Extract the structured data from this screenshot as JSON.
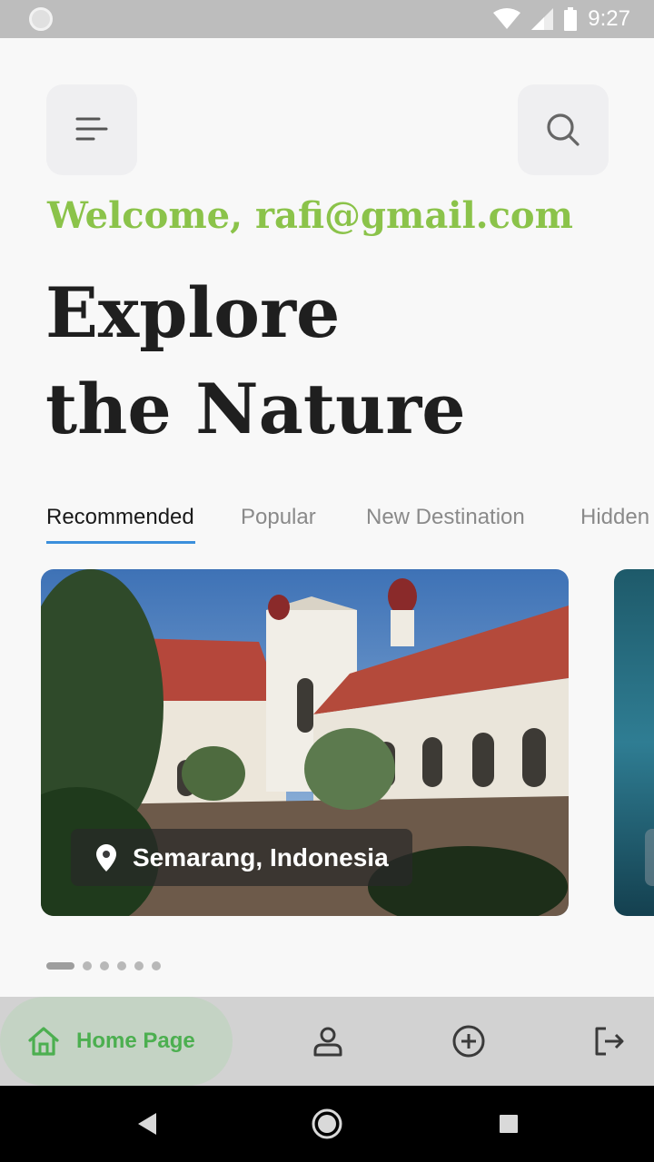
{
  "status_bar": {
    "time": "9:27"
  },
  "header": {
    "welcome": "Welcome, rafi@gmail.com",
    "headline_line1": "Explore",
    "headline_line2": "the Nature"
  },
  "tabs": [
    {
      "label": "Recommended",
      "active": true
    },
    {
      "label": "Popular",
      "active": false
    },
    {
      "label": "New Destination",
      "active": false
    },
    {
      "label": "Hidden",
      "active": false
    }
  ],
  "cards": [
    {
      "location": "Semarang, Indonesia",
      "image": "colonial-building-photo"
    },
    {
      "location": "",
      "image": "water-photo"
    }
  ],
  "carousel": {
    "total": 6,
    "current": 1
  },
  "bottom_nav": {
    "home_label": "Home Page",
    "items": [
      "home-icon",
      "profile-icon",
      "add-circle-icon",
      "logout-icon"
    ]
  },
  "colors": {
    "accent_green": "#8bc34a",
    "home_green": "#4caf50",
    "tab_underline": "#3b8fdc"
  }
}
